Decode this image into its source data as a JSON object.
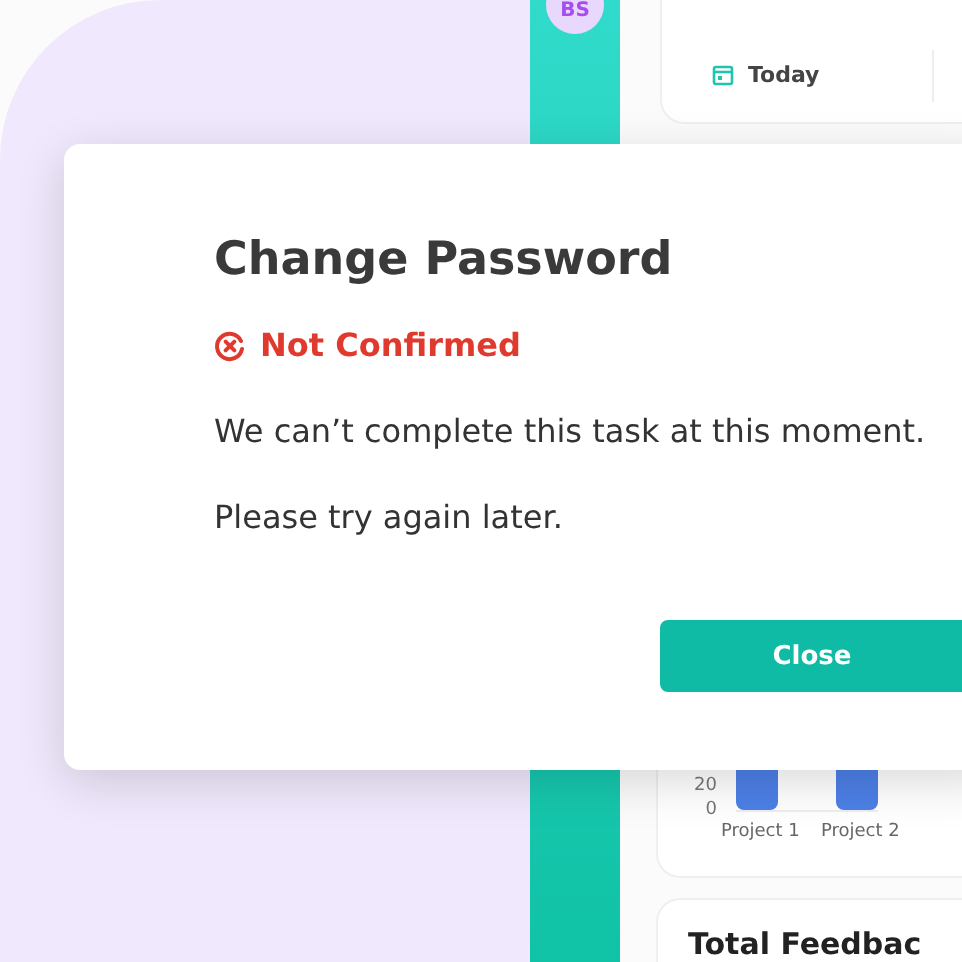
{
  "background": {
    "avatar": "BS",
    "date_filter": "Today",
    "chart": {
      "y_labels": [
        "20",
        "0"
      ],
      "categories": [
        "Project 1",
        "Project 2"
      ]
    },
    "feedback_title": "Total Feedbac"
  },
  "dialog": {
    "title": "Change Password",
    "status": {
      "kind": "error",
      "label": "Not Confirmed"
    },
    "messages": [
      "We can’t complete this task at this moment.",
      "Please try again later."
    ],
    "button": "Close"
  }
}
